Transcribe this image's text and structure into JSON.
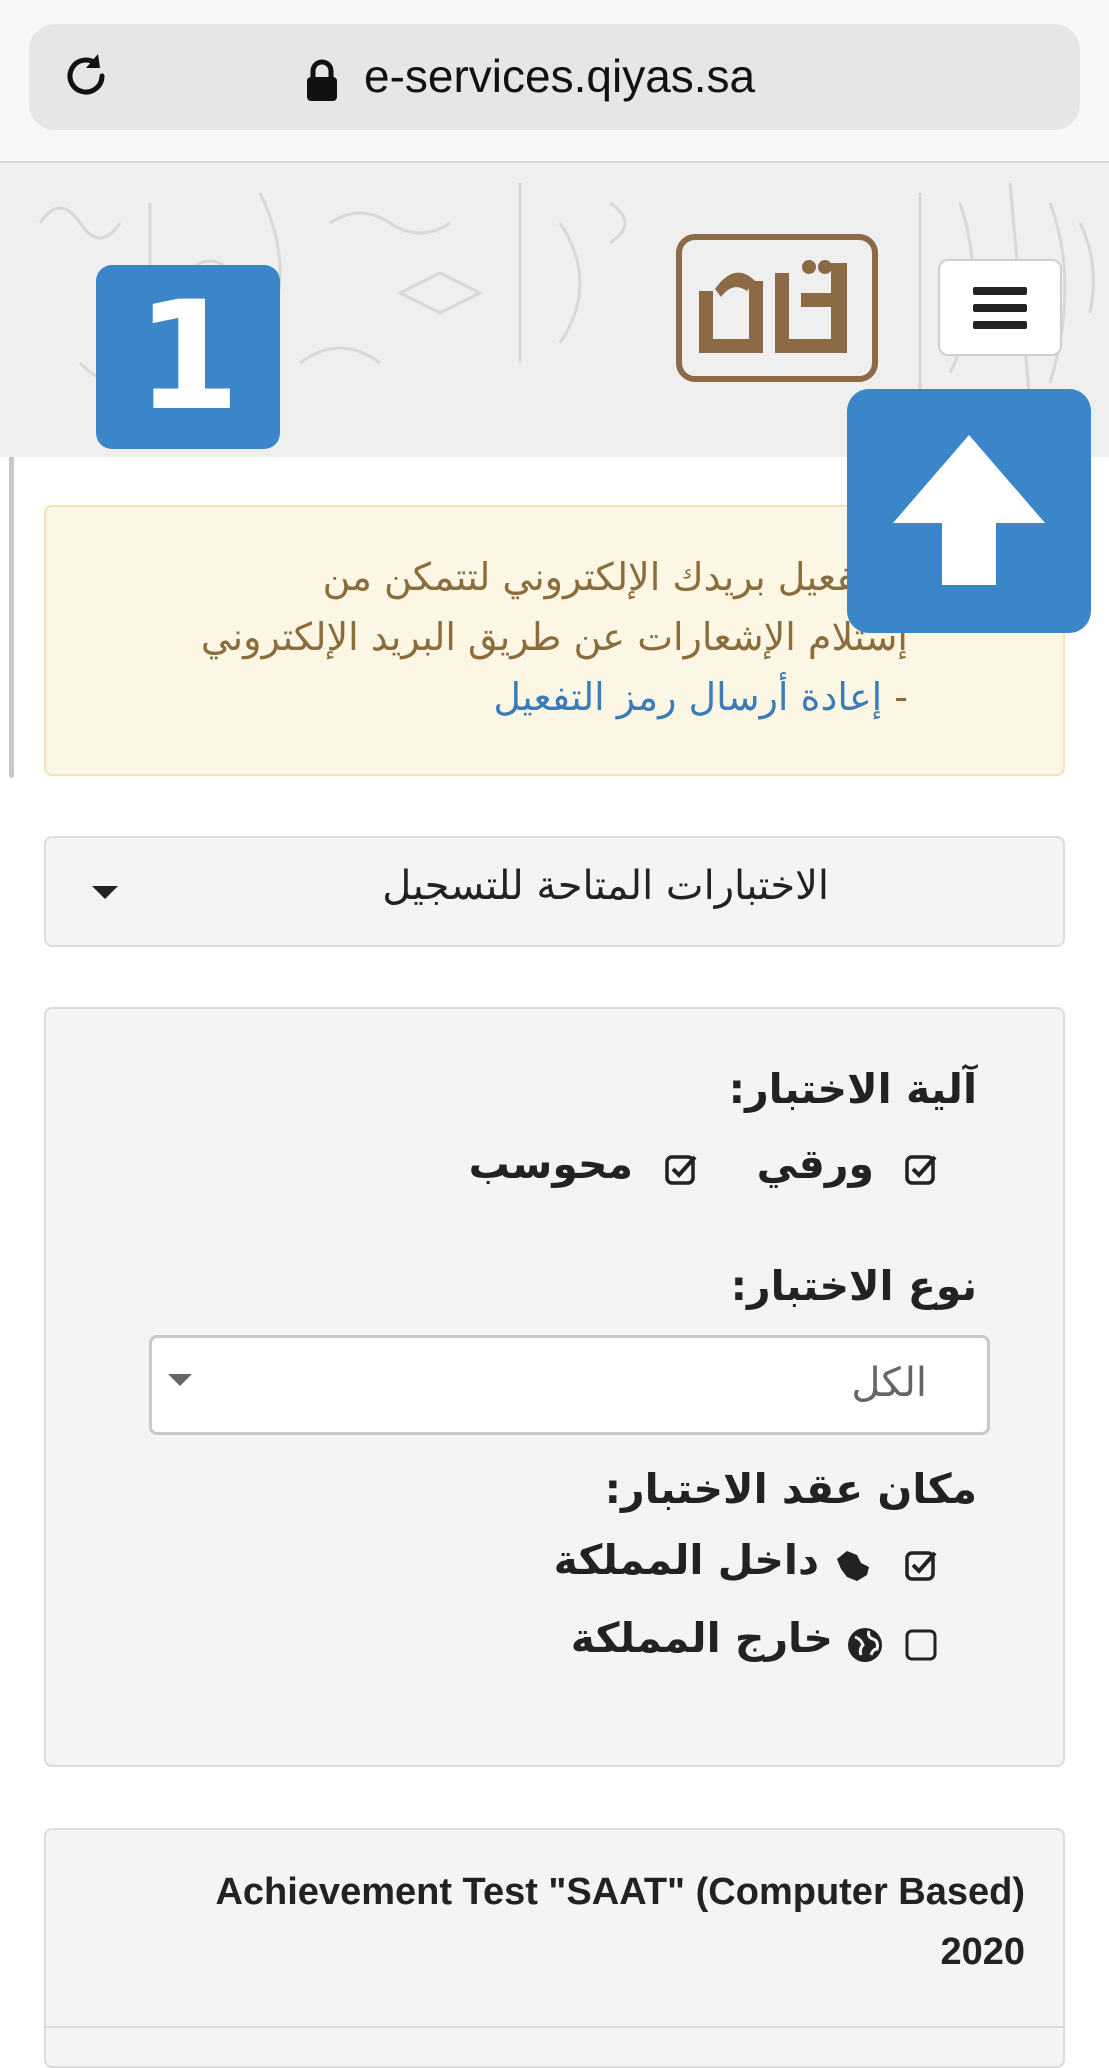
{
  "browser": {
    "url": "e-services.qiyas.sa"
  },
  "header": {
    "step_badge": "1"
  },
  "alert": {
    "line1": "ى تفعيل بريدك الإلكتروني لتتمكن من",
    "line2": "إستلام الإشعارات عن طريق البريد الإلكتروني",
    "link_prefix": "- ",
    "link_text": "إعادة أرسال رمز التفعيل"
  },
  "exams_dropdown": {
    "label": "الاختبارات المتاحة للتسجيل"
  },
  "filters": {
    "method_label": "آلية الاختبار:",
    "method_options": [
      {
        "label": "ورقي",
        "checked": true
      },
      {
        "label": "محوسب",
        "checked": true
      }
    ],
    "type_label": "نوع الاختبار:",
    "type_value": "الكل",
    "location_label": "مكان عقد الاختبار:",
    "location_options": [
      {
        "label": "داخل المملكة",
        "checked": true,
        "icon": "saudi-map-icon"
      },
      {
        "label": "خارج المملكة",
        "checked": false,
        "icon": "globe-icon"
      }
    ]
  },
  "result": {
    "title_line1": "Achievement Test \"SAAT\" (Computer Based)",
    "title_line2": "2020"
  },
  "colors": {
    "accent_blue": "#3a86c8",
    "alert_bg": "#fcf7e4",
    "alert_text": "#8a6d3b",
    "logo_brown": "#8b6a45"
  }
}
